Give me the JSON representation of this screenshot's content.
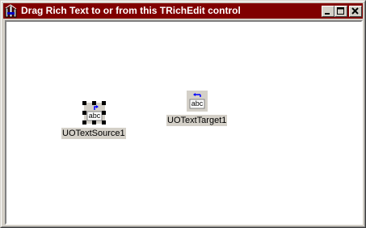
{
  "window": {
    "title": "Drag Rich Text to or from this TRichEdit control",
    "title_icon": "app-icon",
    "controls": [
      "minimize-icon",
      "maximize-icon",
      "close-icon"
    ]
  },
  "components": [
    {
      "name": "UOTextSource1",
      "icon": "text-source-icon",
      "icon_text": "abc",
      "selected": true
    },
    {
      "name": "UOTextTarget1",
      "icon": "text-target-icon",
      "icon_text": "abc",
      "selected": false
    }
  ],
  "colors": {
    "titlebar": "#800000",
    "face": "#d4d0c8",
    "client": "#ffffff",
    "arrow": "#0000ff"
  }
}
